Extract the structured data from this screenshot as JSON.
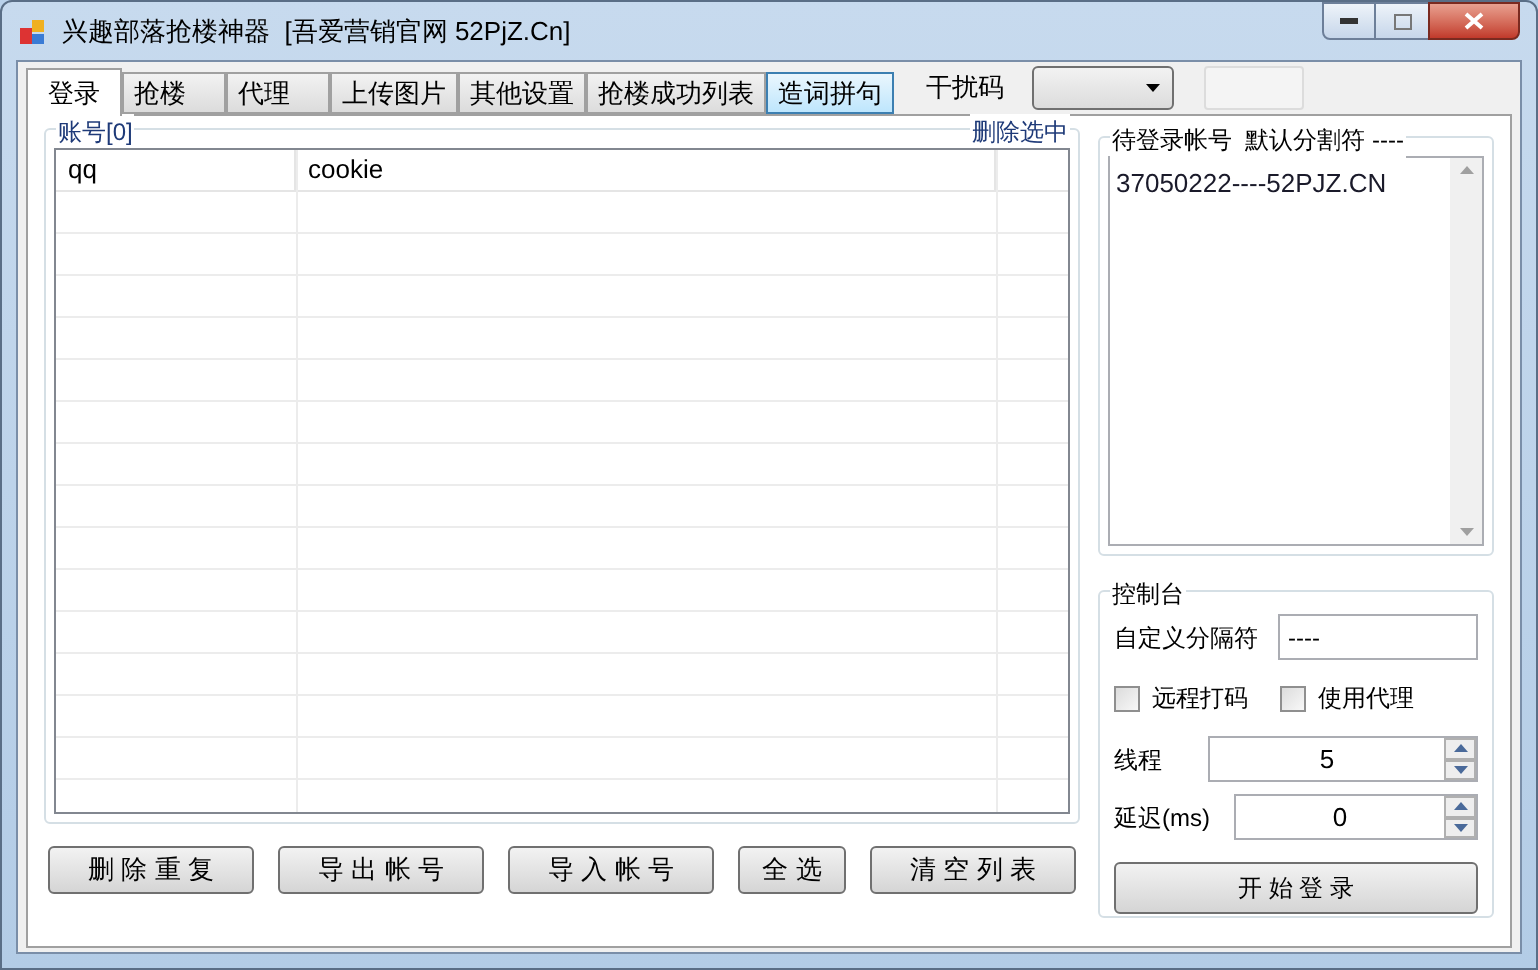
{
  "window": {
    "title": "兴趣部落抢楼神器  [吾爱营销官网 52PjZ.Cn]"
  },
  "tabs": [
    {
      "label": "登录",
      "selected": true,
      "hover": false
    },
    {
      "label": "抢楼",
      "selected": false,
      "hover": false
    },
    {
      "label": "代理",
      "selected": false,
      "hover": false
    },
    {
      "label": "上传图片",
      "selected": false,
      "hover": false
    },
    {
      "label": "其他设置",
      "selected": false,
      "hover": false
    },
    {
      "label": "抢楼成功列表",
      "selected": false,
      "hover": false
    },
    {
      "label": "造词拼句",
      "selected": false,
      "hover": true
    }
  ],
  "captcha": {
    "label": "干扰码"
  },
  "accounts": {
    "title": "账号[0]",
    "delete_link": "删除选中",
    "columns": [
      "qq",
      "cookie"
    ]
  },
  "pending": {
    "title": "待登录帐号  默认分割符 ----",
    "lines": [
      "37050222----52PJZ.CN"
    ]
  },
  "console": {
    "title": "控制台",
    "separator_label": "自定义分隔符",
    "separator_value": "----",
    "checkboxes": [
      {
        "label": "远程打码",
        "checked": false
      },
      {
        "label": "使用代理",
        "checked": false
      }
    ],
    "spinners": [
      {
        "label": "线程",
        "value": "5"
      },
      {
        "label": "延迟(ms)",
        "value": "0"
      }
    ],
    "start_button": "开 始 登 录"
  },
  "buttons": [
    "删 除 重 复",
    "导 出 帐 号",
    "导 入 帐 号",
    "全 选",
    "清 空 列 表"
  ]
}
